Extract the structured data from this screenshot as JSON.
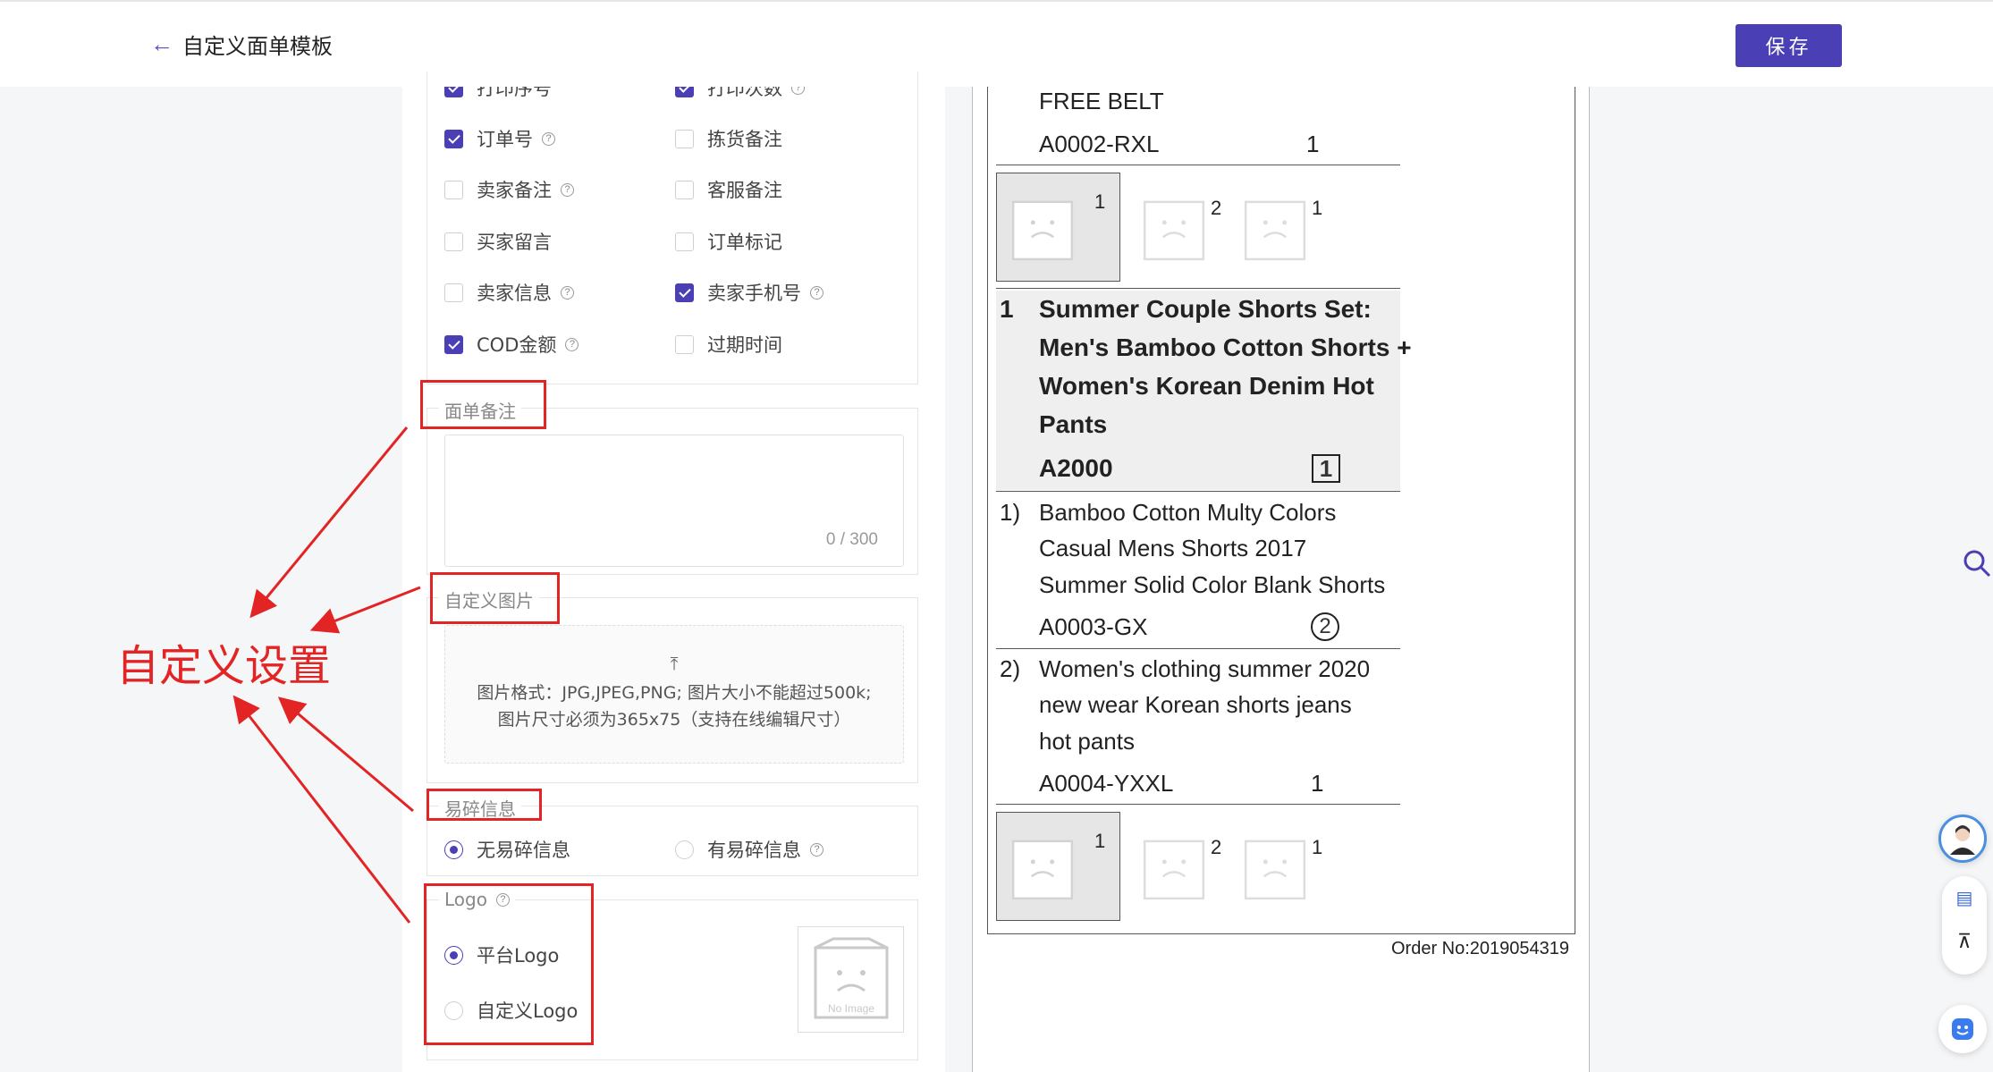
{
  "header": {
    "back_label": "自定义面单模板",
    "save_label": "保存"
  },
  "options": {
    "row0": [
      {
        "label": "打印序号",
        "checked": true
      },
      {
        "label": "打印次数",
        "checked": true
      }
    ],
    "rows": [
      {
        "left": {
          "label": "订单号",
          "checked": true,
          "help": true
        },
        "right": {
          "label": "拣货备注",
          "checked": false,
          "help": false
        }
      },
      {
        "left": {
          "label": "卖家备注",
          "checked": false,
          "help": true
        },
        "right": {
          "label": "客服备注",
          "checked": false,
          "help": false
        }
      },
      {
        "left": {
          "label": "买家留言",
          "checked": false,
          "help": false
        },
        "right": {
          "label": "订单标记",
          "checked": false,
          "help": false
        }
      },
      {
        "left": {
          "label": "卖家信息",
          "checked": false,
          "help": true
        },
        "right": {
          "label": "卖家手机号",
          "checked": true,
          "help": true
        }
      },
      {
        "left": {
          "label": "COD金额",
          "checked": true,
          "help": true
        },
        "right": {
          "label": "过期时间",
          "checked": false,
          "help": false
        }
      }
    ]
  },
  "note": {
    "legend": "面单备注",
    "counter": "0 / 300"
  },
  "image": {
    "legend": "自定义图片",
    "line1": "图片格式：JPG,JPEG,PNG; 图片大小不能超过500k;",
    "line2": "图片尺寸必须为365x75（支持在线编辑尺寸）"
  },
  "fragile": {
    "legend": "易碎信息",
    "opt_none": "无易碎信息",
    "opt_has": "有易碎信息"
  },
  "logo": {
    "legend": "Logo",
    "opt_platform": "平台Logo",
    "opt_custom": "自定义Logo",
    "noimage": "No Image"
  },
  "annotation": {
    "text": "自定义设置"
  },
  "preview": {
    "item_top_name": "FREE BELT",
    "item_top_sku": "A0002-RXL",
    "item_top_qty": "1",
    "thumbs1": [
      "1",
      "2",
      "1"
    ],
    "product_index": "1",
    "product_title": [
      "Summer Couple Shorts Set:",
      "Men's Bamboo Cotton Shorts +",
      "Women's Korean Denim Hot",
      "Pants"
    ],
    "product_sku": "A2000",
    "product_qty": "1",
    "sub1_index": "1)",
    "sub1_title": [
      "Bamboo Cotton Multy Colors",
      "Casual Mens Shorts 2017",
      "Summer Solid Color Blank Shorts"
    ],
    "sub1_sku": "A0003-GX",
    "sub1_qty": "2",
    "sub2_index": "2)",
    "sub2_title": [
      "Women's clothing summer 2020",
      "new wear Korean shorts jeans",
      "hot pants"
    ],
    "sub2_sku": "A0004-YXXL",
    "sub2_qty": "1",
    "thumbs2": [
      "1",
      "2",
      "1"
    ],
    "order_no": "Order No:2019054319"
  }
}
